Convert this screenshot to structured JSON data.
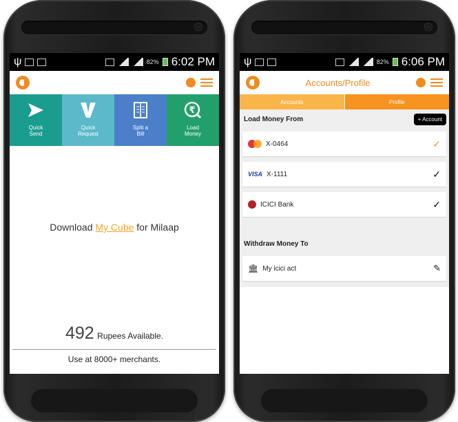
{
  "left_phone": {
    "status_bar": {
      "time": "6:02 PM",
      "battery": "82%"
    },
    "tiles": [
      {
        "label": "Quick\nSend",
        "icon": "send-arrow-icon",
        "color": "#1a9d8f"
      },
      {
        "label": "Quick\nRequest",
        "icon": "request-v-icon",
        "color": "#5bb9c9"
      },
      {
        "label": "Split a\nBill",
        "icon": "bill-icon",
        "color": "#4b7fc9"
      },
      {
        "label": "Load\nMoney",
        "icon": "rupee-coin-icon",
        "color": "#22a06b"
      }
    ],
    "download": {
      "prefix": "Download",
      "link": "My Cube",
      "suffix": "for Milaap"
    },
    "balance": {
      "amount": "492",
      "label": "Rupees Available."
    },
    "merchants": "Use at 8000+ merchants."
  },
  "right_phone": {
    "status_bar": {
      "time": "6:06 PM",
      "battery": "82%"
    },
    "title": "Accounts/Profile",
    "tabs": {
      "accounts": "Accounts",
      "profile": "Profile"
    },
    "load_money": {
      "title": "Load Money From",
      "add_label": "+ Account",
      "items": [
        {
          "name": "X-0464",
          "icon": "mastercard-icon",
          "check_color": "#f7931e"
        },
        {
          "name": "X-1111",
          "icon": "visa-icon",
          "check_color": "#111111"
        },
        {
          "name": "ICICI Bank",
          "icon": "icici-icon",
          "check_color": "#111111"
        }
      ]
    },
    "withdraw": {
      "title": "Withdraw Money To",
      "items": [
        {
          "name": "My icici act",
          "icon": "bank-icon"
        }
      ]
    }
  },
  "colors": {
    "accent": "#f28b1e",
    "accent_light": "#f9b54a",
    "link": "#f5a623"
  }
}
